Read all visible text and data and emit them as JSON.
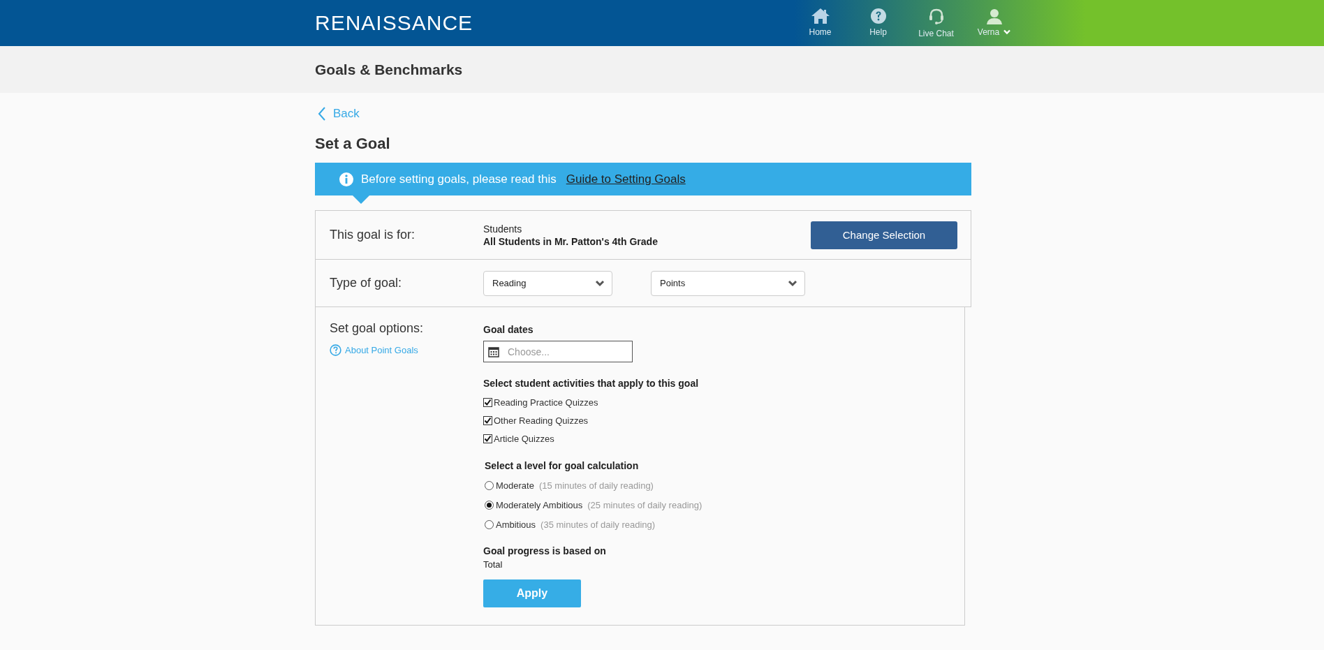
{
  "header": {
    "logo": "RENAISSANCE",
    "nav": [
      {
        "kind": "home",
        "label": "Home"
      },
      {
        "kind": "help",
        "label": "Help"
      },
      {
        "kind": "chat",
        "label": "Live Chat"
      },
      {
        "kind": "user",
        "label": "Verna",
        "dropdown": true
      }
    ]
  },
  "subheader": {
    "title": "Goals & Benchmarks"
  },
  "back": {
    "label": "Back"
  },
  "page_title": "Set a Goal",
  "banner": {
    "text": "Before setting goals, please read this",
    "link": "Guide to Setting Goals"
  },
  "goal_for": {
    "label": "This goal is for:",
    "group": "Students",
    "name": "All Students in Mr. Patton's 4th Grade",
    "button": "Change Selection"
  },
  "goal_type": {
    "label": "Type of goal:",
    "selects": [
      {
        "value": "Reading"
      },
      {
        "value": "Points"
      }
    ]
  },
  "options": {
    "label": "Set goal options:",
    "help_link": "About Point Goals",
    "dates": {
      "heading": "Goal dates",
      "placeholder": "Choose..."
    },
    "activities": {
      "heading": "Select student activities that apply to this goal",
      "items": [
        {
          "label": "Reading Practice Quizzes",
          "checked": true
        },
        {
          "label": "Other Reading Quizzes",
          "checked": true
        },
        {
          "label": "Article Quizzes",
          "checked": true
        }
      ]
    },
    "levels": {
      "heading": "Select a level for goal calculation",
      "items": [
        {
          "label": "Moderate",
          "note": "(15 minutes of daily reading)",
          "selected": false
        },
        {
          "label": "Moderately Ambitious",
          "note": "(25 minutes of daily reading)",
          "selected": true
        },
        {
          "label": "Ambitious",
          "note": "(35 minutes of daily reading)",
          "selected": false
        }
      ]
    },
    "progress": {
      "heading": "Goal progress is based on",
      "value": "Total"
    },
    "apply": "Apply"
  }
}
